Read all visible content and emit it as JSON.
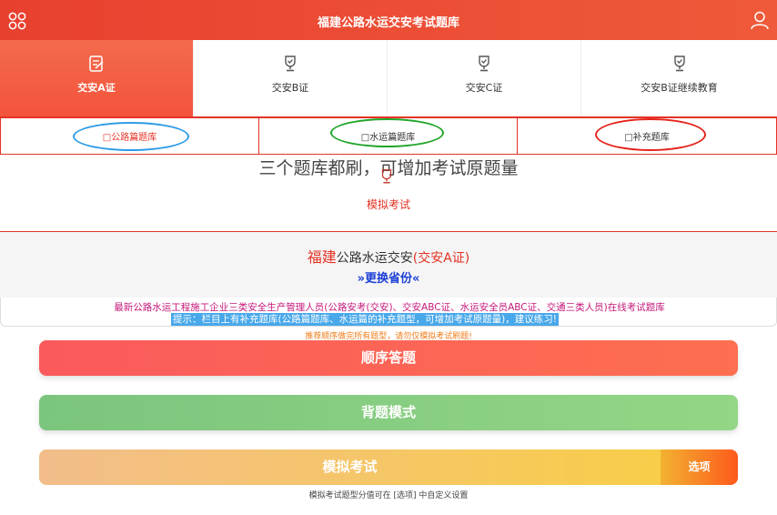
{
  "header": {
    "title": "福建公路水运交安考试题库",
    "menu_icon": "grid-menu-icon",
    "user_icon": "user-icon"
  },
  "cert_tabs": [
    {
      "label": "交安A证",
      "icon": "document-edit-icon",
      "active": true
    },
    {
      "label": "交安B证",
      "icon": "trophy-icon",
      "active": false
    },
    {
      "label": "交安C证",
      "icon": "trophy-icon",
      "active": false
    },
    {
      "label": "交安B证继续教育",
      "icon": "trophy-icon",
      "active": false
    }
  ],
  "bank_tabs": [
    {
      "label": "□公路篇题库",
      "active": true,
      "circle_color": "#2e9be6"
    },
    {
      "label": "□水运篇题库",
      "active": false,
      "circle_color": "#22a52b"
    },
    {
      "label": "□补充题库",
      "active": false,
      "circle_color": "#e5231a"
    }
  ],
  "annotation": "三个题库都刷，可增加考试原题量",
  "mock_exam_label": "模拟考试",
  "province": {
    "region": "福建",
    "text": "公路水运交安",
    "cert": "(交安A证)",
    "change_label": "»更换省份«"
  },
  "info": {
    "line1": "最新公路水运工程施工企业三类安全生产管理人员(公路安考(交安)、交安ABC证、水运安全员ABC证、交通三类人员)在线考试题库",
    "line2": "提示：栏目上有补充题库(公路篇题库、水运篇的补充题型，可增加考试原题量)，建议练习!",
    "line3": "推荐顺序做完所有题型，请勿仅模拟考试刷题!"
  },
  "buttons": {
    "order": "顺序答题",
    "memorize": "背题模式",
    "mock": "模拟考试",
    "options": "选项"
  },
  "footer_note": "模拟考试题型分值可在 [选项] 中自定义设置",
  "colors": {
    "brand_red": "#e53224",
    "link_blue": "#1a3fd6",
    "highlight_blue": "#48a8ea"
  }
}
